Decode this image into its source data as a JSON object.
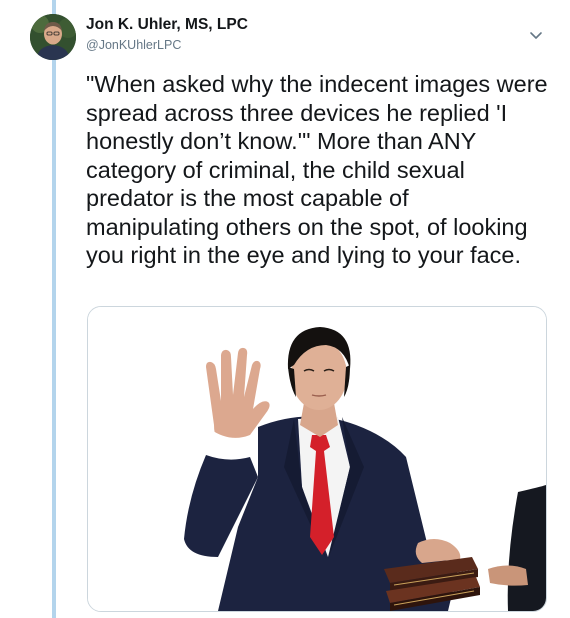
{
  "tweet": {
    "author_name": "Jon K. Uhler, MS, LPC",
    "author_handle": "@JonKUhlerLPC",
    "text": "\"When asked why the indecent images were spread across three devices he replied 'I honestly don’t know.'\" More than ANY category of criminal, the child sexual predator is the most capable of manipulating others on the spot, of looking you right in the eye and lying to your face.",
    "menu_icon": "chevron-down-icon",
    "avatar_icon": "profile-photo",
    "media_description_icon": "man-swearing-oath-on-books-photo"
  },
  "colors": {
    "thread_line": "#b3d4ec",
    "text": "#14171a",
    "handle": "#657786",
    "tie": "#d4202a",
    "suit": "#1c2340"
  }
}
